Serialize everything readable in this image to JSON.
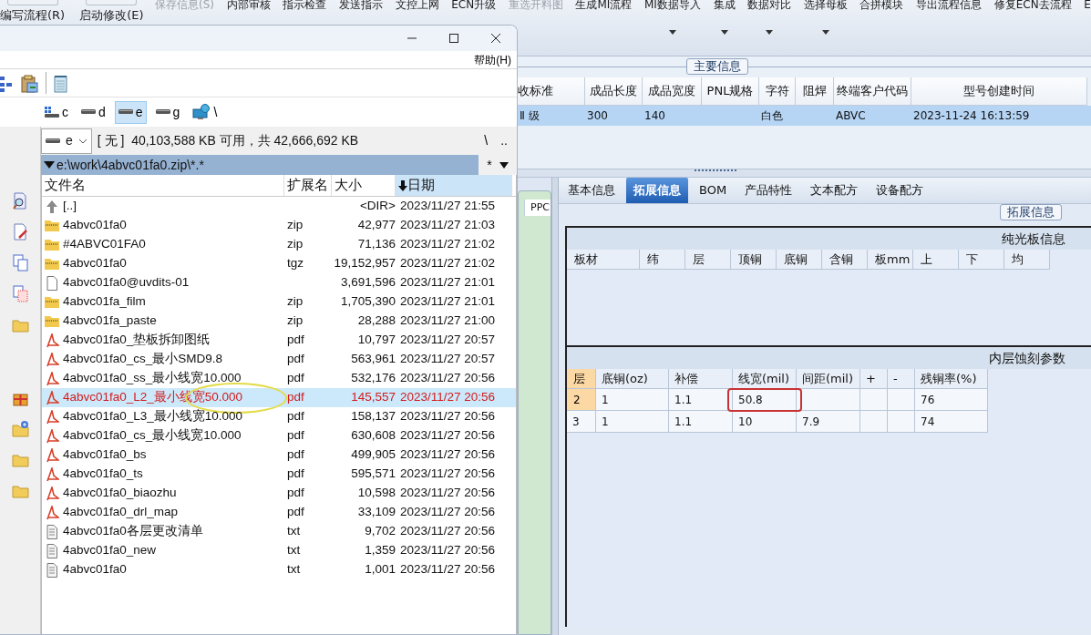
{
  "ribbon": {
    "large_buttons": [
      {
        "label": "编写流程(R)"
      },
      {
        "label": "启动修改(E)"
      }
    ],
    "commands": [
      {
        "label": "保存信息(S)",
        "disabled": true,
        "dropdown": false
      },
      {
        "label": "内部审核",
        "disabled": false,
        "dropdown": false
      },
      {
        "label": "指示检查",
        "disabled": false,
        "dropdown": false
      },
      {
        "label": "发送指示",
        "disabled": false,
        "dropdown": false
      },
      {
        "label": "文控上网",
        "disabled": false,
        "dropdown": false
      },
      {
        "label": "ECN升级",
        "disabled": false,
        "dropdown": false
      },
      {
        "label": "重选开料图",
        "disabled": true,
        "dropdown": false
      },
      {
        "label": "生成MI流程",
        "disabled": false,
        "dropdown": false
      },
      {
        "label": "MI数据导入",
        "disabled": false,
        "dropdown": true
      },
      {
        "label": "集成",
        "disabled": false,
        "dropdown": true
      },
      {
        "label": "数据对比",
        "disabled": false,
        "dropdown": true
      },
      {
        "label": "选择母板",
        "disabled": false,
        "dropdown": true
      },
      {
        "label": "合拼模块",
        "disabled": false,
        "dropdown": false
      },
      {
        "label": "导出流程信息",
        "disabled": false,
        "dropdown": false
      },
      {
        "label": "修复ECN去流程",
        "disabled": false,
        "dropdown": false
      },
      {
        "label": "E",
        "disabled": false,
        "dropdown": false
      }
    ]
  },
  "main_info": {
    "title": "主要信息",
    "columns": [
      "收标准",
      "成品长度",
      "成品宽度",
      "PNL规格",
      "字符",
      "阻焊",
      "终端客户代码",
      "型号创建时间"
    ],
    "rows": [
      {
        "selected": true,
        "cells": [
          "Ⅱ 级",
          "300",
          "140",
          null,
          "白色",
          null,
          "ABVC",
          "2023-11-24 16:13:59"
        ]
      }
    ]
  },
  "side_list": {
    "columns": [
      "PPC"
    ]
  },
  "detail_panel": {
    "tabs": [
      {
        "label": "基本信息",
        "selected": false
      },
      {
        "label": "拓展信息",
        "selected": true
      },
      {
        "label": "BOM",
        "selected": false
      },
      {
        "label": "产品特性",
        "selected": false
      },
      {
        "label": "文本配方",
        "selected": false
      },
      {
        "label": "设备配方",
        "selected": false
      }
    ],
    "group_title": "拓展信息",
    "plain_board": {
      "title": "纯光板信息",
      "columns": [
        "板材",
        "纬",
        "层",
        "顶铜",
        "底铜",
        "含铜",
        "板mm",
        "上",
        "下",
        "均"
      ]
    },
    "etch": {
      "title": "内层蚀刻参数",
      "columns": [
        "层",
        "底铜(oz)",
        "补偿",
        "线宽(mil)",
        "间距(mil)",
        "+",
        "-",
        "残铜率(%)"
      ],
      "rows": [
        {
          "selected": true,
          "cells": [
            {
              "text": "2"
            },
            {
              "text": "1"
            },
            {
              "text": "1.1"
            },
            {
              "text": "50.8",
              "circled": true
            },
            {},
            {},
            {},
            {
              "text": "76"
            }
          ]
        },
        {
          "selected": false,
          "cells": [
            {
              "text": "3"
            },
            {
              "text": "1"
            },
            {
              "text": "1.1"
            },
            {
              "text": "10"
            },
            {
              "text": "7.9"
            },
            {},
            {},
            {
              "text": "74"
            }
          ]
        }
      ]
    }
  },
  "file_manager": {
    "menu": [
      "帮助(H)"
    ],
    "toolbar": [
      {
        "kind": "tree"
      },
      {
        "kind": "clipboard"
      },
      {
        "kind": "separator"
      },
      {
        "kind": "notepad"
      }
    ],
    "drives": [
      {
        "letter": "c",
        "kind": "system",
        "selected": false
      },
      {
        "letter": "d",
        "kind": "disk",
        "selected": false
      },
      {
        "letter": "e",
        "kind": "disk",
        "selected": true
      },
      {
        "letter": "g",
        "kind": "disk",
        "selected": false
      },
      {
        "letter": "\\",
        "kind": "network",
        "selected": false
      }
    ],
    "drive_combo": {
      "value": "e"
    },
    "free_space": "[ 无 ]  40,103,588 KB 可用，共 42,666,692 KB",
    "nav_buttons": [
      "\\",
      ".."
    ],
    "path": "e:\\work\\4abvc01fa0.zip\\*.*",
    "filter": "*",
    "side_tools_upper": [
      {
        "kind": "find"
      },
      {
        "kind": "edit"
      },
      {
        "kind": "copy"
      },
      {
        "kind": "copy_dotted"
      },
      {
        "kind": "folder"
      }
    ],
    "side_tools_lower": [
      {
        "kind": "gift"
      },
      {
        "kind": "folder_plus"
      },
      {
        "kind": "folder"
      },
      {
        "kind": "folder"
      }
    ],
    "columns": [
      {
        "label": "文件名",
        "sorted": false
      },
      {
        "label": "扩展名",
        "sorted": false
      },
      {
        "label": "大小",
        "sorted": false
      },
      {
        "label": "日期",
        "sorted": true
      }
    ],
    "files": [
      {
        "kind": "parent",
        "name": "[..]",
        "size": "<DIR>",
        "date": "2023/11/27 21:55",
        "selected": false,
        "circled": false
      },
      {
        "kind": "archive",
        "name": "4abvc01fa0",
        "ext": "zip",
        "size": "42,977",
        "date": "2023/11/27 21:03",
        "selected": false,
        "circled": false
      },
      {
        "kind": "archive",
        "name": "#4ABVC01FA0",
        "ext": "zip",
        "size": "71,136",
        "date": "2023/11/27 21:02",
        "selected": false,
        "circled": false
      },
      {
        "kind": "archive",
        "name": "4abvc01fa0",
        "ext": "tgz",
        "size": "19,152,957",
        "date": "2023/11/27 21:02",
        "selected": false,
        "circled": false
      },
      {
        "kind": "file",
        "name": "4abvc01fa0@uvdits-01",
        "size": "3,691,596",
        "date": "2023/11/27 21:01",
        "selected": false,
        "circled": false
      },
      {
        "kind": "archive",
        "name": "4abvc01fa_film",
        "ext": "zip",
        "size": "1,705,390",
        "date": "2023/11/27 21:01",
        "selected": false,
        "circled": false
      },
      {
        "kind": "archive",
        "name": "4abvc01fa_paste",
        "ext": "zip",
        "size": "28,288",
        "date": "2023/11/27 21:00",
        "selected": false,
        "circled": false
      },
      {
        "kind": "pdf",
        "name": "4abvc01fa0_垫板拆卸图纸",
        "ext": "pdf",
        "size": "10,797",
        "date": "2023/11/27 20:57",
        "selected": false,
        "circled": false
      },
      {
        "kind": "pdf",
        "name": "4abvc01fa0_cs_最小SMD9.8",
        "ext": "pdf",
        "size": "563,961",
        "date": "2023/11/27 20:57",
        "selected": false,
        "circled": false
      },
      {
        "kind": "pdf",
        "name": "4abvc01fa0_ss_最小线宽10.000",
        "ext": "pdf",
        "size": "532,176",
        "date": "2023/11/27 20:56",
        "selected": false,
        "circled": false
      },
      {
        "kind": "pdf",
        "name": "4abvc01fa0_L2_最小线宽50.000",
        "ext": "pdf",
        "size": "145,557",
        "date": "2023/11/27 20:56",
        "selected": true,
        "circled": true
      },
      {
        "kind": "pdf",
        "name": "4abvc01fa0_L3_最小线宽10.000",
        "ext": "pdf",
        "size": "158,137",
        "date": "2023/11/27 20:56",
        "selected": false,
        "circled": false
      },
      {
        "kind": "pdf",
        "name": "4abvc01fa0_cs_最小线宽10.000",
        "ext": "pdf",
        "size": "630,608",
        "date": "2023/11/27 20:56",
        "selected": false,
        "circled": false
      },
      {
        "kind": "pdf",
        "name": "4abvc01fa0_bs",
        "ext": "pdf",
        "size": "499,905",
        "date": "2023/11/27 20:56",
        "selected": false,
        "circled": false
      },
      {
        "kind": "pdf",
        "name": "4abvc01fa0_ts",
        "ext": "pdf",
        "size": "595,571",
        "date": "2023/11/27 20:56",
        "selected": false,
        "circled": false
      },
      {
        "kind": "pdf",
        "name": "4abvc01fa0_biaozhu",
        "ext": "pdf",
        "size": "10,598",
        "date": "2023/11/27 20:56",
        "selected": false,
        "circled": false
      },
      {
        "kind": "pdf",
        "name": "4abvc01fa0_drl_map",
        "ext": "pdf",
        "size": "33,109",
        "date": "2023/11/27 20:56",
        "selected": false,
        "circled": false
      },
      {
        "kind": "text",
        "name": "4abvc01fa0各层更改清单",
        "ext": "txt",
        "size": "9,702",
        "date": "2023/11/27 20:56",
        "selected": false,
        "circled": false
      },
      {
        "kind": "text",
        "name": "4abvc01fa0_new",
        "ext": "txt",
        "size": "1,359",
        "date": "2023/11/27 20:56",
        "selected": false,
        "circled": false
      },
      {
        "kind": "text",
        "name": "4abvc01fa0",
        "ext": "txt",
        "size": "1,001",
        "date": "2023/11/27 20:56",
        "selected": false,
        "circled": false
      }
    ]
  }
}
